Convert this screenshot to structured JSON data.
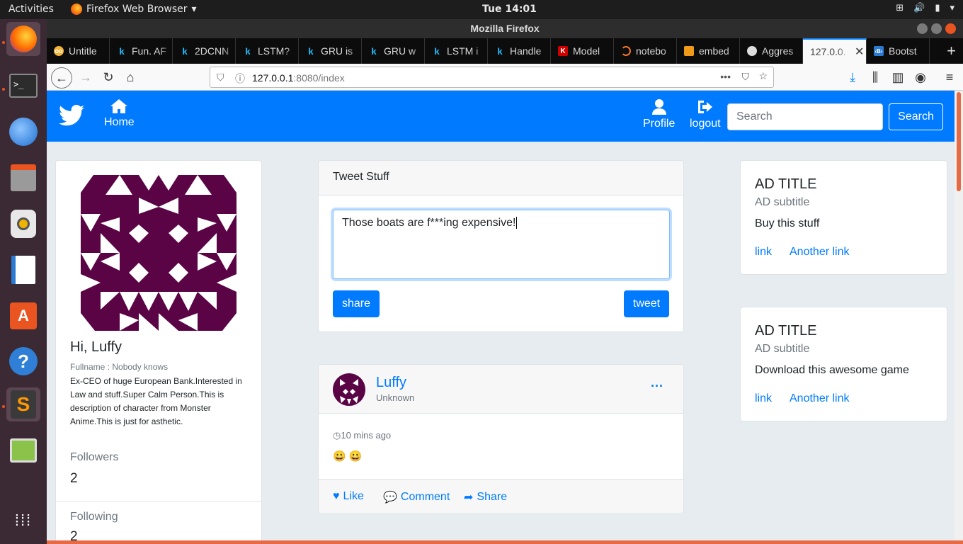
{
  "topbar": {
    "activities": "Activities",
    "app_name": "Firefox Web Browser",
    "clock": "Tue 14:01"
  },
  "window": {
    "title": "Mozilla Firefox"
  },
  "tabs": [
    {
      "label": "Untitle",
      "icon": "jupyter-icon"
    },
    {
      "label": "Fun. AF",
      "icon": "kaggle-icon"
    },
    {
      "label": "2DCNN",
      "icon": "kaggle-icon"
    },
    {
      "label": "LSTM?",
      "icon": "kaggle-icon"
    },
    {
      "label": "GRU is",
      "icon": "kaggle-icon"
    },
    {
      "label": "GRU w",
      "icon": "kaggle-icon"
    },
    {
      "label": "LSTM i",
      "icon": "kaggle-icon"
    },
    {
      "label": "Handle",
      "icon": "kaggle-icon"
    },
    {
      "label": "Model",
      "icon": "keras-icon"
    },
    {
      "label": "notebo",
      "icon": "jupyter-ring-icon"
    },
    {
      "label": "embed",
      "icon": "book-icon"
    },
    {
      "label": "Aggres",
      "icon": "github-icon"
    },
    {
      "label": "127.0.0.",
      "icon": "none"
    },
    {
      "label": "Bootst",
      "icon": "bootstrap-icon"
    }
  ],
  "urlbar": {
    "host": "127.0.0.1",
    "rest": ":8080/index"
  },
  "site": {
    "home": "Home",
    "profile": "Profile",
    "logout": "logout",
    "search_placeholder": "Search",
    "search_button": "Search"
  },
  "profile": {
    "greeting": "Hi, Luffy",
    "fullname": "Fullname : Nobody knows",
    "description": "Ex-CEO of huge European Bank.Interested in Law and stuff.Super Calm Person.This is description of character from Monster Anime.This is just for asthetic.",
    "followers_label": "Followers",
    "followers_value": "2",
    "following_label": "Following",
    "following_value": "2"
  },
  "compose": {
    "header": "Tweet Stuff",
    "text": "Those boats are f***ing expensive!",
    "share": "share",
    "tweet": "tweet"
  },
  "tweet": {
    "name": "Luffy",
    "sub": "Unknown",
    "time": "10 mins ago",
    "content": "😀 😀",
    "like": "Like",
    "comment": "Comment",
    "share": "Share"
  },
  "ads": [
    {
      "title": "AD TITLE",
      "subtitle": "AD subtitle",
      "text": "Buy this stuff",
      "link1": "link",
      "link2": "Another link"
    },
    {
      "title": "AD TITLE",
      "subtitle": "AD subtitle",
      "text": "Download this awesome game",
      "link1": "link",
      "link2": "Another link"
    }
  ],
  "colors": {
    "primary": "#007bff",
    "avatar": "#5a0446"
  }
}
